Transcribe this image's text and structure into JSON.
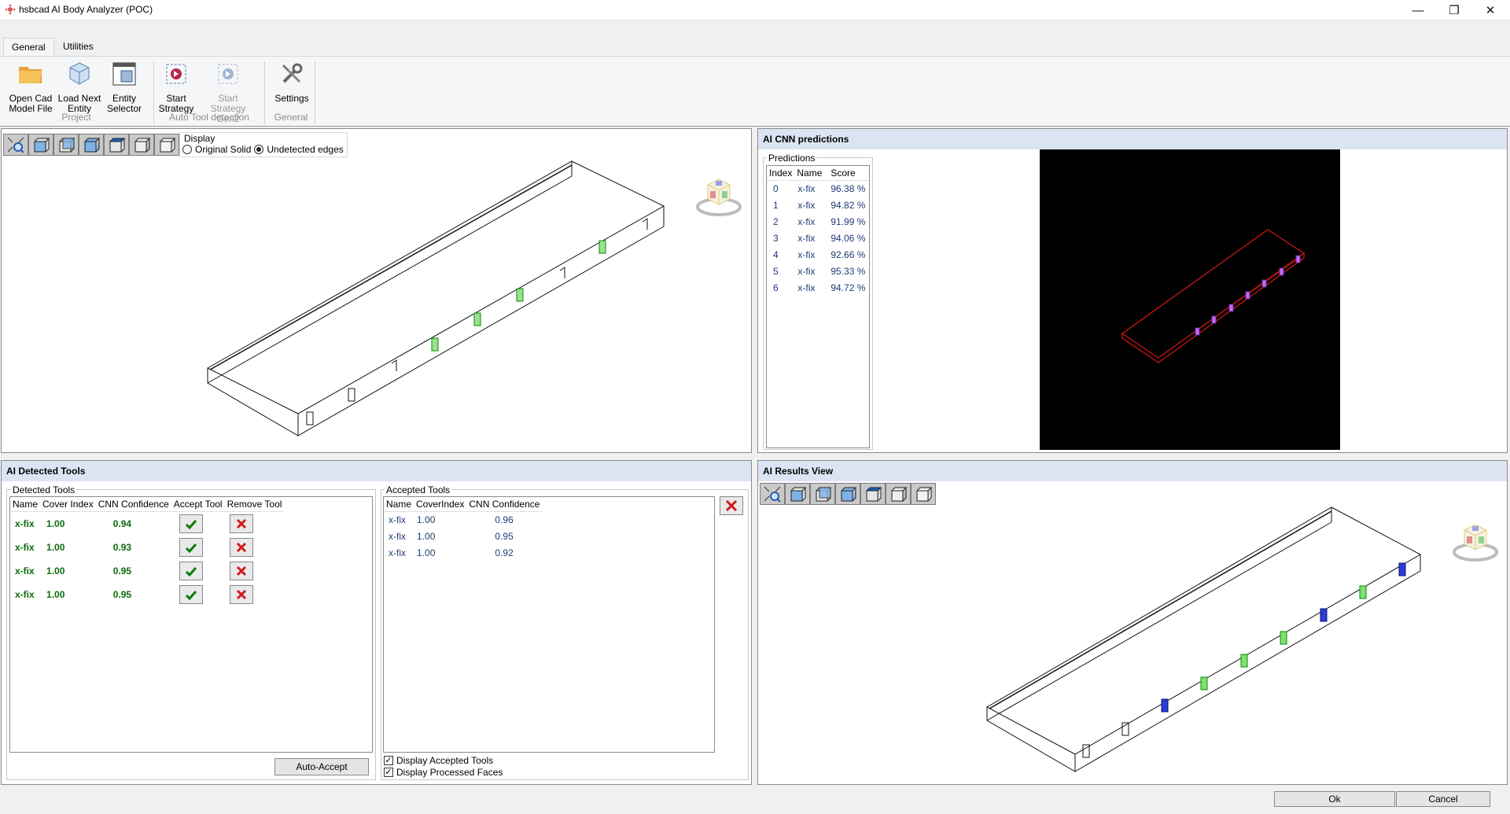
{
  "window": {
    "title": "hsbcad AI Body Analyzer (POC)"
  },
  "tabs": [
    "General",
    "Utilities"
  ],
  "ribbon": {
    "buttons": {
      "open_cad": "Open Cad\nModel File",
      "load_next": "Load Next\nEntity",
      "entity_selector": "Entity\nSelector",
      "start_strategy": "Start\nStrategy",
      "start_strategy_gen2": "Start\nStrategy Gen2",
      "settings": "Settings"
    },
    "groups": {
      "project": "Project",
      "auto_tool_detection": "Auto Tool detection",
      "general": "General"
    }
  },
  "viewer": {
    "display_label": "Display",
    "radio_original": "Original Solid",
    "radio_undetected": "Undetected edges",
    "selected": "Undetected edges"
  },
  "cnn": {
    "title": "AI CNN predictions",
    "group_label": "Predictions",
    "columns": [
      "Index",
      "Name",
      "Score"
    ],
    "rows": [
      [
        "0",
        "x-fix",
        "96.38 %"
      ],
      [
        "1",
        "x-fix",
        "94.82 %"
      ],
      [
        "2",
        "x-fix",
        "91.99 %"
      ],
      [
        "3",
        "x-fix",
        "94.06 %"
      ],
      [
        "4",
        "x-fix",
        "92.66 %"
      ],
      [
        "5",
        "x-fix",
        "95.33 %"
      ],
      [
        "6",
        "x-fix",
        "94.72 %"
      ]
    ]
  },
  "detected": {
    "title": "AI Detected Tools",
    "group_label": "Detected Tools",
    "columns": [
      "Name",
      "Cover Index",
      "CNN Confidence",
      "Accept Tool",
      "Remove Tool"
    ],
    "rows": [
      [
        "x-fix",
        "1.00",
        "0.94"
      ],
      [
        "x-fix",
        "1.00",
        "0.93"
      ],
      [
        "x-fix",
        "1.00",
        "0.95"
      ],
      [
        "x-fix",
        "1.00",
        "0.95"
      ]
    ],
    "auto_accept": "Auto-Accept"
  },
  "accepted": {
    "group_label": "Accepted Tools",
    "columns": [
      "Name",
      "CoverIndex",
      "CNN Confidence"
    ],
    "rows": [
      [
        "x-fix",
        "1.00",
        "0.96"
      ],
      [
        "x-fix",
        "1.00",
        "0.95"
      ],
      [
        "x-fix",
        "1.00",
        "0.92"
      ]
    ],
    "check_display_accepted": "Display Accepted Tools",
    "check_display_processed": "Display Processed Faces"
  },
  "results": {
    "title": "AI Results View"
  },
  "footer": {
    "ok": "Ok",
    "cancel": "Cancel"
  },
  "colors": {
    "header_bg": "#dbe4f2",
    "green": "#0b6b0b",
    "blue_text": "#1f3a78",
    "red_x": "#d11a1a"
  }
}
